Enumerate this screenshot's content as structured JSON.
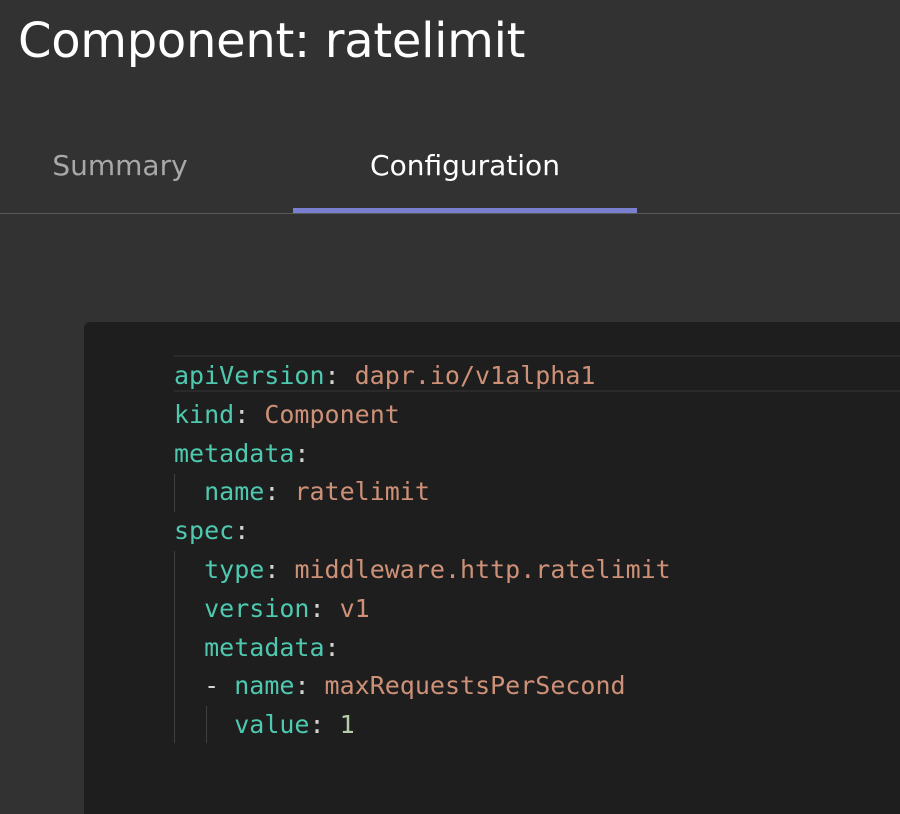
{
  "page": {
    "title": "Component: ratelimit"
  },
  "tabs": [
    {
      "label": "Summary",
      "active": false
    },
    {
      "label": "Configuration",
      "active": true
    }
  ],
  "colors": {
    "accent": "#7a7fd0",
    "key": "#4ec9b0",
    "string": "#ce9178",
    "number": "#b5cea8",
    "punctuation": "#d4d4d4"
  },
  "editor": {
    "language": "yaml",
    "lines": [
      {
        "indent": "",
        "dash": "",
        "key": "apiVersion",
        "sep": ":",
        "value": " dapr.io/v1alpha1",
        "value_type": "string"
      },
      {
        "indent": "",
        "dash": "",
        "key": "kind",
        "sep": ":",
        "value": " Component",
        "value_type": "string"
      },
      {
        "indent": "",
        "dash": "",
        "key": "metadata",
        "sep": ":",
        "value": "",
        "value_type": "string"
      },
      {
        "indent": "  ",
        "dash": "",
        "key": "name",
        "sep": ":",
        "value": " ratelimit",
        "value_type": "string"
      },
      {
        "indent": "",
        "dash": "",
        "key": "spec",
        "sep": ":",
        "value": "",
        "value_type": "string"
      },
      {
        "indent": "  ",
        "dash": "",
        "key": "type",
        "sep": ":",
        "value": " middleware.http.ratelimit",
        "value_type": "string"
      },
      {
        "indent": "  ",
        "dash": "",
        "key": "version",
        "sep": ":",
        "value": " v1",
        "value_type": "string"
      },
      {
        "indent": "  ",
        "dash": "",
        "key": "metadata",
        "sep": ":",
        "value": "",
        "value_type": "string"
      },
      {
        "indent": "  ",
        "dash": "- ",
        "key": "name",
        "sep": ":",
        "value": " maxRequestsPerSecond",
        "value_type": "string"
      },
      {
        "indent": "    ",
        "dash": "",
        "key": "value",
        "sep": ":",
        "value": " 1",
        "value_type": "number"
      }
    ]
  }
}
